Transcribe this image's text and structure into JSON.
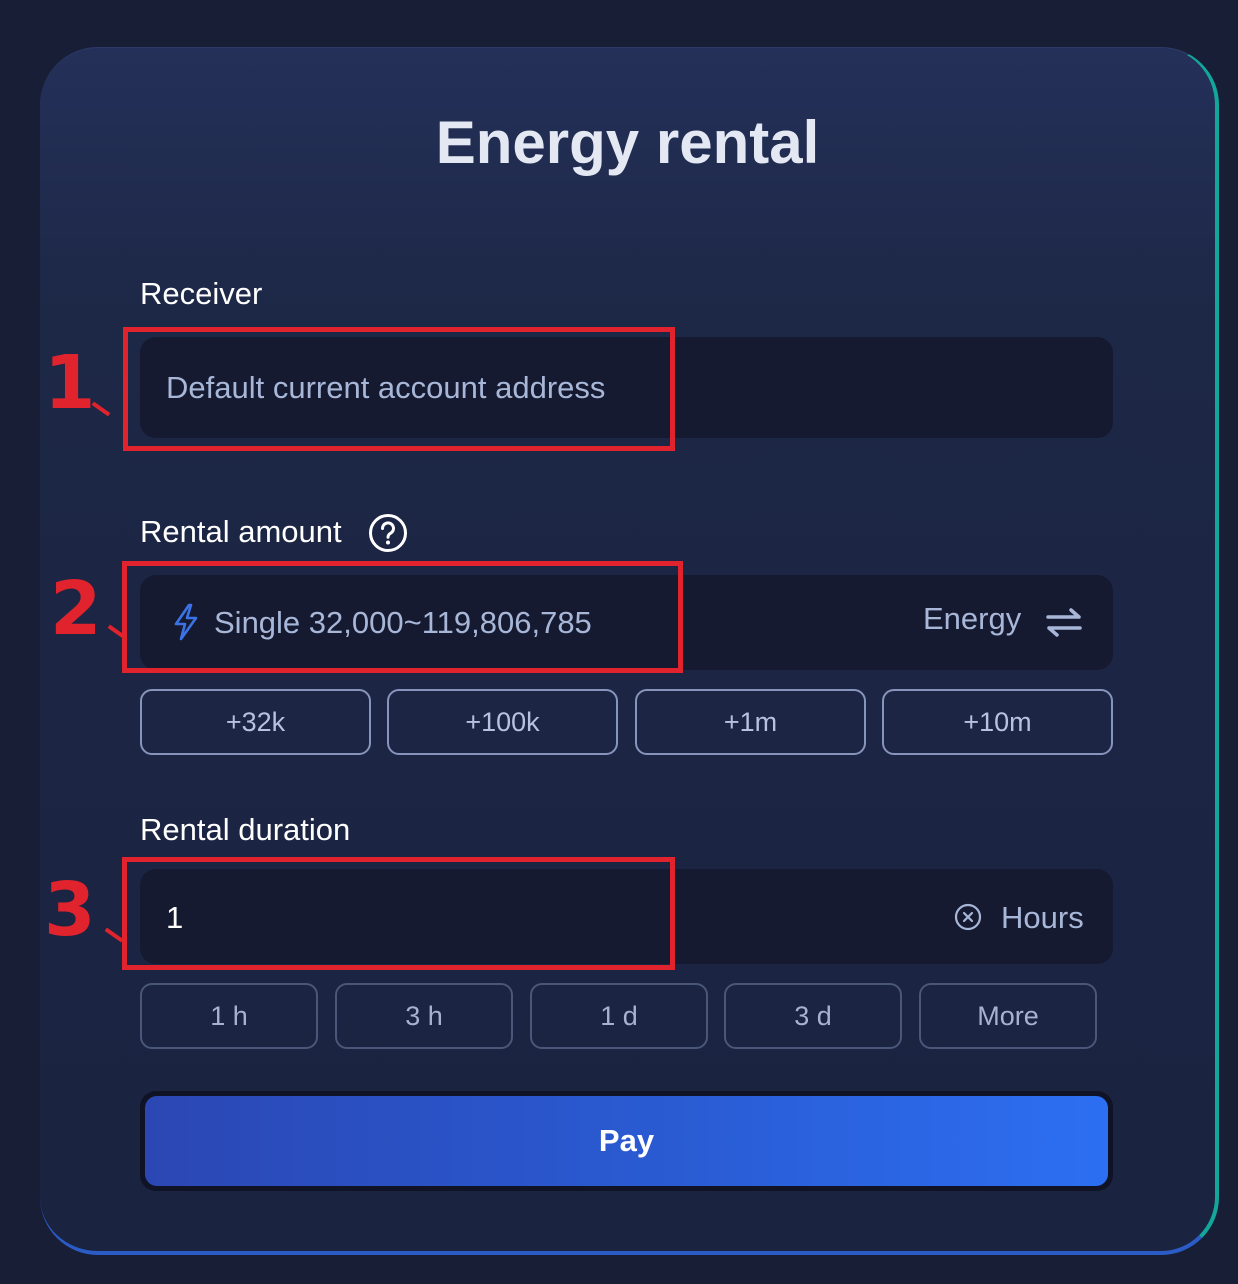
{
  "title": "Energy rental",
  "receiver": {
    "label": "Receiver",
    "placeholder": "Default current account address"
  },
  "rental_amount": {
    "label": "Rental amount",
    "help_icon": "question-circle-icon",
    "input_icon": "lightning-icon",
    "placeholder": "Single 32,000~119,806,785",
    "unit": "Energy",
    "swap_icon": "swap-arrows-icon",
    "quick_amounts": [
      "+32k",
      "+100k",
      "+1m",
      "+10m"
    ]
  },
  "rental_duration": {
    "label": "Rental duration",
    "value": "1",
    "clear_icon": "close-circle-icon",
    "unit": "Hours",
    "quick_durations": [
      "1 h",
      "3 h",
      "1 d",
      "3 d",
      "More"
    ]
  },
  "pay_label": "Pay",
  "annotations": {
    "step_1": "1",
    "step_2": "2",
    "step_3": "3",
    "color": "#e0232c"
  },
  "colors": {
    "background": "#171e36",
    "field": "#151a30",
    "accent_teal": "#13a79b",
    "pay_blue": "#2c6ff2"
  }
}
